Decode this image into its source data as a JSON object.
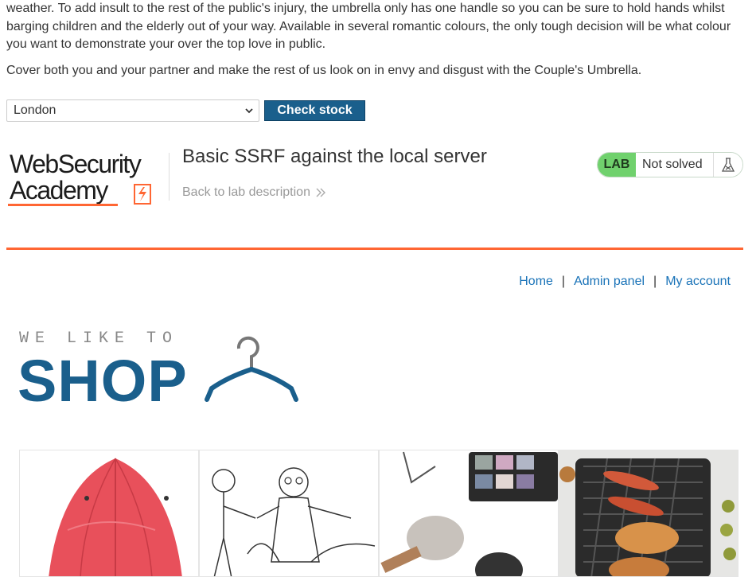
{
  "description": {
    "para1": "weather. To add insult to the rest of the public's injury, the umbrella only has one handle so you can be sure to hold hands whilst barging children and the elderly out of your way. Available in several romantic colours, the only tough decision will be what colour you want to demonstrate your over the top love in public.",
    "para2": "Cover both you and your partner and make the rest of us look on in envy and disgust with the Couple's Umbrella."
  },
  "stock_form": {
    "selected_store": "London",
    "button_label": "Check stock"
  },
  "lab_banner": {
    "logo_line1": "WebSecurity",
    "logo_line2": "Academy",
    "title": "Basic SSRF against the local server",
    "back_link": "Back to lab description",
    "lab_tag": "LAB",
    "status": "Not solved",
    "accent_color": "#ff6633",
    "lab_tag_color": "#70d16d"
  },
  "nav": {
    "home": "Home",
    "admin": "Admin panel",
    "account": "My account",
    "separator": "|"
  },
  "shop_logo": {
    "tagline": "WE LIKE TO",
    "word": "SHOP"
  },
  "products": [
    {
      "icon": "umbrella-image"
    },
    {
      "icon": "sketch-people-image"
    },
    {
      "icon": "makeup-brushes-image"
    },
    {
      "icon": "bbq-grill-image"
    }
  ]
}
